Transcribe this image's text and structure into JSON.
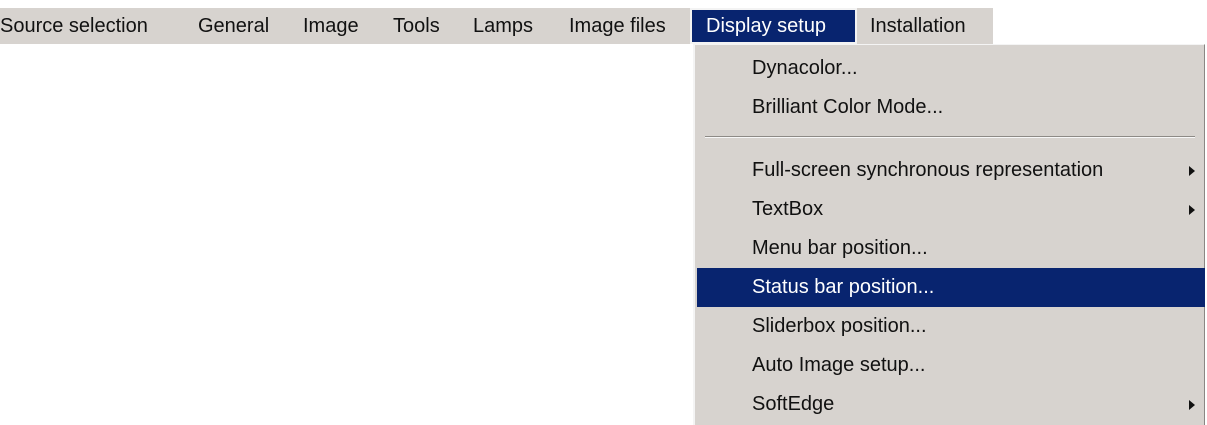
{
  "menu_bar": {
    "items": [
      {
        "label": "Source selection"
      },
      {
        "label": "General"
      },
      {
        "label": "Image"
      },
      {
        "label": "Tools"
      },
      {
        "label": "Lamps"
      },
      {
        "label": "Image files"
      },
      {
        "label": "Display setup",
        "state": "open"
      },
      {
        "label": "Installation"
      }
    ]
  },
  "display_setup_menu": {
    "items": [
      {
        "label": "Dynacolor..."
      },
      {
        "label": "Brilliant Color Mode..."
      },
      {
        "label": "Full-screen synchronous representation",
        "submenu_icon": "chevron-right-icon"
      },
      {
        "label": "TextBox",
        "submenu_icon": "chevron-right-icon"
      },
      {
        "label": "Menu bar position..."
      },
      {
        "label": "Status bar position...",
        "state": "highlighted"
      },
      {
        "label": "Sliderbox position..."
      },
      {
        "label": "Auto Image setup..."
      },
      {
        "label": "SoftEdge",
        "submenu_icon": "chevron-right-icon"
      }
    ]
  },
  "colors": {
    "menu_background": "#d7d3cf",
    "selection_background": "#08246f",
    "selection_text": "#ffffff",
    "text": "#111111"
  }
}
